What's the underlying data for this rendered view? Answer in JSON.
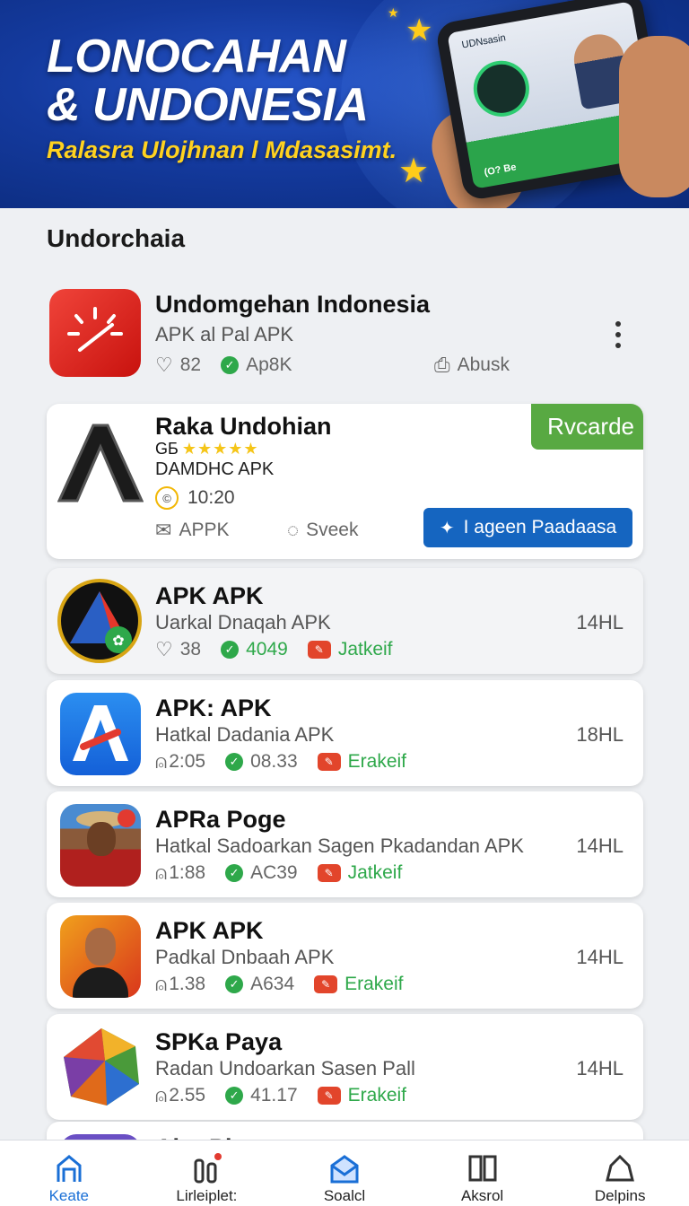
{
  "banner": {
    "title_line1": "LONOCAHAN",
    "title_line2": "& UNDONESIA",
    "subtitle": "Ralasra Ulojhnan l Mdasasimt.",
    "tablet_top_text": "UDNsasin",
    "tablet_bottom_text": "(O? Be"
  },
  "section_title": "Undorchaia",
  "featured": {
    "name": "Undomgehan Indonesia",
    "subtitle": "APK al Pal APK",
    "likes": "82",
    "stat": "Ap8K",
    "action": "Abusk",
    "icon": "timer-icon",
    "accent": "#e53a2c"
  },
  "highlight": {
    "name": "Raka Undohian",
    "rating_prefix": "GБ",
    "stars": "★★★★★",
    "subtitle": "DAMDHC APK",
    "time": "10:20",
    "badge": "Rvcarde",
    "link1": "APPK",
    "link2": "Sveek",
    "button": "I ageen Paadaasa",
    "icon": "letter-a-icon"
  },
  "apps": [
    {
      "name": "APK APK",
      "subtitle": "Uarkal Dnaqah APK",
      "stat1": "38",
      "stat2": "4049",
      "tag": "Jatkeif",
      "size": "14HL",
      "icon": "triangle-badge-icon"
    },
    {
      "name": "APK: APK",
      "subtitle": "Hatkal Dadania APK",
      "stat1": "2:05",
      "stat2": "08.33",
      "tag": "Erakeif",
      "size": "18HL",
      "icon": "a-logo-icon"
    },
    {
      "name": "APRa Poge",
      "subtitle": "Hatkal Sadoarkan Sagen Pkadandan APK",
      "stat1": "1:88",
      "stat2": "AC39",
      "tag": "Jatkeif",
      "size": "14HL",
      "icon": "person-photo-icon"
    },
    {
      "name": "APK APK",
      "subtitle": "Padkal Dnbaah APK",
      "stat1": "1.38",
      "stat2": "A634",
      "tag": "Erakeif",
      "size": "14HL",
      "icon": "portrait-icon"
    },
    {
      "name": "SPKa Paya",
      "subtitle": "Radan Undoarkan Sasen Pall",
      "stat1": "2.55",
      "stat2": "41.17",
      "tag": "Erakeif",
      "size": "14HL",
      "icon": "polyhedron-icon"
    }
  ],
  "partial_row_name": "Aitn Pl",
  "nav": [
    {
      "label": "Keate",
      "icon": "home-icon",
      "active": true
    },
    {
      "label": "Lirleiplet:",
      "icon": "chart-icon",
      "active": false
    },
    {
      "label": "Soalcl",
      "icon": "mail-icon",
      "active": false
    },
    {
      "label": "Aksrol",
      "icon": "book-icon",
      "active": false
    },
    {
      "label": "Delpins",
      "icon": "home-outline-icon",
      "active": false
    }
  ]
}
